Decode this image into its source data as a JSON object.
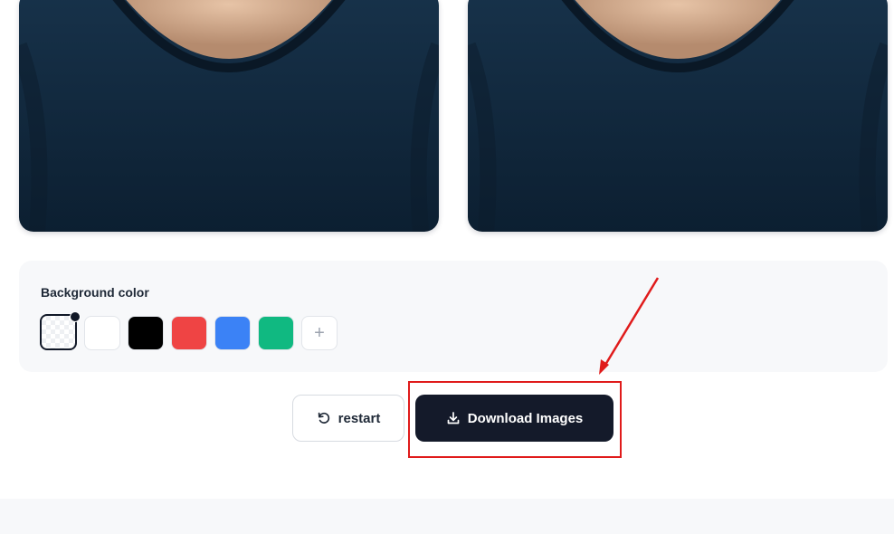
{
  "images": [
    {
      "name": "original-photo"
    },
    {
      "name": "processed-photo"
    }
  ],
  "background_panel": {
    "title": "Background color",
    "swatches": [
      {
        "name": "transparent",
        "color": "transparent",
        "selected": true
      },
      {
        "name": "white",
        "color": "#ffffff"
      },
      {
        "name": "black",
        "color": "#000000"
      },
      {
        "name": "red",
        "color": "#ef4444"
      },
      {
        "name": "blue",
        "color": "#3b82f6"
      },
      {
        "name": "green",
        "color": "#10b981"
      }
    ],
    "add_label": "+"
  },
  "actions": {
    "restart_label": "restart",
    "restart_icon": "rotate-ccw-icon",
    "download_label": "Download Images",
    "download_icon": "download-icon"
  },
  "annotation": {
    "color": "#e01b1b",
    "target": "download-images-button"
  }
}
